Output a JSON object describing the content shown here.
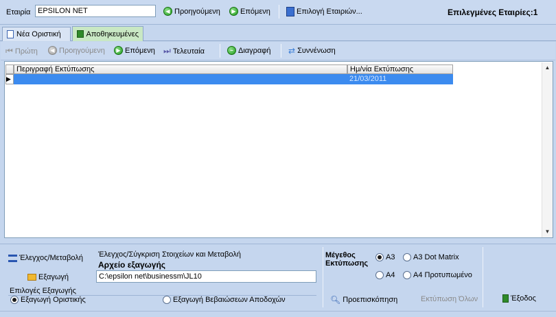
{
  "company": {
    "label": "Εταιρία",
    "value": "EPSILON NET"
  },
  "topnav": {
    "previous": "Προηγούμενη",
    "next": "Επόμενη",
    "select_companies": "Επιλογή Εταιριών..."
  },
  "selected_companies": {
    "label": "Επιλεγμένες Εταιρίες:",
    "count": "1"
  },
  "tabs": [
    {
      "label": "Νέα Οριστική"
    },
    {
      "label": "Αποθηκευμένες"
    }
  ],
  "toolbar": {
    "first": "Πρώτη",
    "previous": "Προηγούμενη",
    "next": "Επόμενη",
    "last": "Τελευταία",
    "delete": "Διαγραφή",
    "merge": "Συννένωση"
  },
  "grid": {
    "columns": [
      "Περιγραφή Εκτύπωσης",
      "Ημ/νία Εκτύπωσης"
    ],
    "rows": [
      {
        "description": "",
        "date": "21/03/2011"
      }
    ]
  },
  "bottom": {
    "edit_button": "Έλεγχος/Μεταβολή",
    "check_desc": "Έλεγχος/Σύγκριση Στοιχείων και Μεταβολή",
    "export_file_label": "Αρχείο εξαγωγής",
    "export_button": "Εξαγωγή",
    "export_path": "C:\\epsilon net\\businessm\\JL10",
    "export_options_label": "Επιλογές Εξαγωγής",
    "opt_final": "Εξαγωγή Οριστικής",
    "opt_certs": "Εξαγωγή Βεβαιώσεων Αποδοχών",
    "print_size_label_1": "Μέγεθος",
    "print_size_label_2": "Εκτύπωσης",
    "size_a3": "A3",
    "size_a3_dot": "A3 Dot Matrix",
    "size_a4": "A4",
    "size_a4_pre": "A4 Προτυπωμένο",
    "preview": "Προεπισκόπηση",
    "print_all": "Εκτύπωση Όλων",
    "exit": "Έξοδος"
  },
  "colors": {
    "accent_blue": "#3c8bef",
    "panel": "#c5d6ee",
    "green": "#1f9a1c"
  }
}
